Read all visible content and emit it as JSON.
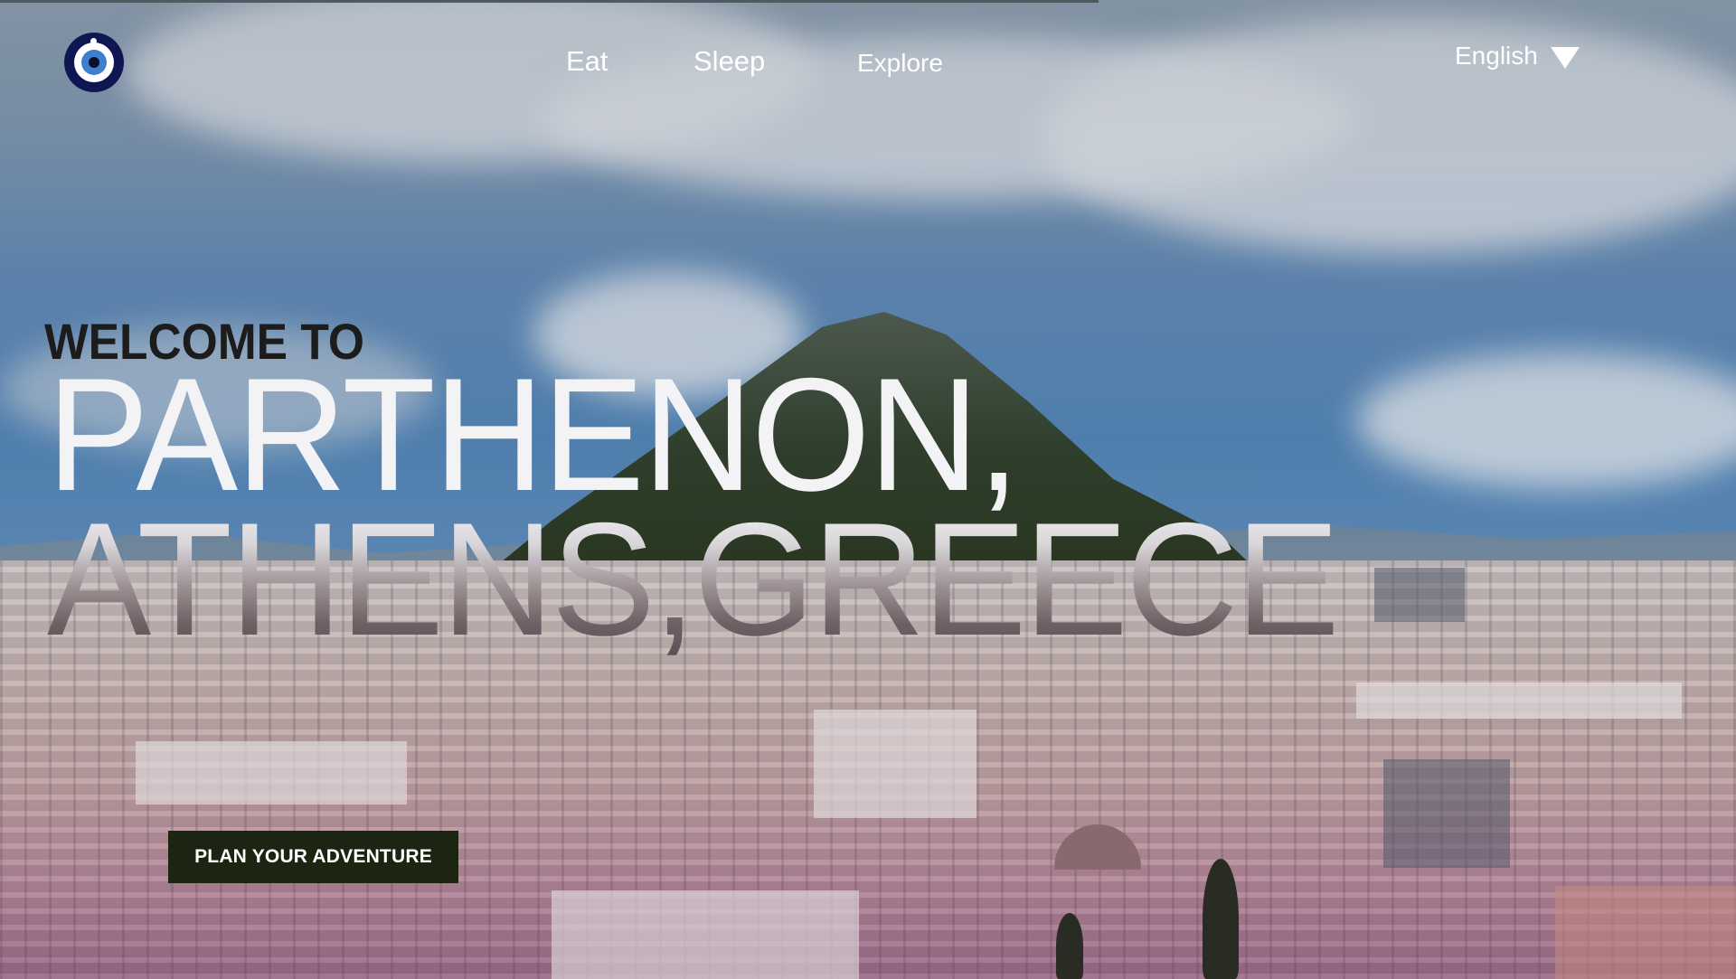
{
  "header": {
    "logo_icon": "evil-eye-icon",
    "nav": [
      {
        "label": "Eat"
      },
      {
        "label": "Sleep"
      },
      {
        "label": "Explore"
      }
    ],
    "language": {
      "selected": "English",
      "icon": "triangle-down-icon"
    }
  },
  "hero": {
    "welcome": "WELCOME TO",
    "title_line1": "PARTHENON,",
    "title_line2": "ATHENS,GREECE",
    "cta_label": "PLAN YOUR ADVENTURE"
  },
  "colors": {
    "logo_bg": "#0e1752",
    "cta_bg": "#1e2412",
    "text_light": "#ffffff",
    "welcome_text": "#1c1c1c"
  }
}
